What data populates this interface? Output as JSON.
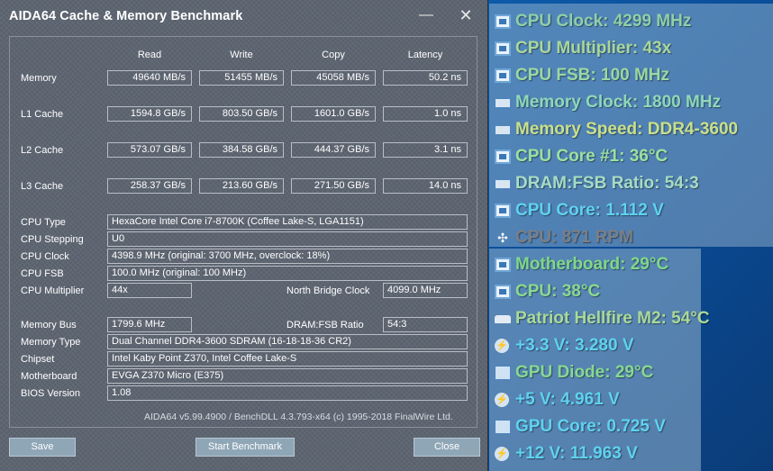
{
  "window": {
    "title": "AIDA64 Cache & Memory Benchmark",
    "min_glyph": "—",
    "close_glyph": "✕"
  },
  "columns": [
    "Read",
    "Write",
    "Copy",
    "Latency"
  ],
  "bench_rows": [
    {
      "label": "Memory",
      "read": "49640 MB/s",
      "write": "51455 MB/s",
      "copy": "45058 MB/s",
      "latency": "50.2 ns"
    },
    {
      "label": "L1 Cache",
      "read": "1594.8 GB/s",
      "write": "803.50 GB/s",
      "copy": "1601.0 GB/s",
      "latency": "1.0 ns"
    },
    {
      "label": "L2 Cache",
      "read": "573.07 GB/s",
      "write": "384.58 GB/s",
      "copy": "444.37 GB/s",
      "latency": "3.1 ns"
    },
    {
      "label": "L3 Cache",
      "read": "258.37 GB/s",
      "write": "213.60 GB/s",
      "copy": "271.50 GB/s",
      "latency": "14.0 ns"
    }
  ],
  "info": {
    "cpu_type": {
      "label": "CPU Type",
      "value": "HexaCore Intel Core i7-8700K  (Coffee Lake-S, LGA1151)"
    },
    "cpu_stepping": {
      "label": "CPU Stepping",
      "value": "U0"
    },
    "cpu_clock": {
      "label": "CPU Clock",
      "value": "4398.9 MHz  (original: 3700 MHz, overclock: 18%)"
    },
    "cpu_fsb": {
      "label": "CPU FSB",
      "value": "100.0 MHz  (original: 100 MHz)"
    },
    "cpu_multiplier": {
      "label": "CPU Multiplier",
      "value": "44x"
    },
    "nb_clock": {
      "label": "North Bridge Clock",
      "value": "4099.0 MHz"
    },
    "memory_bus": {
      "label": "Memory Bus",
      "value": "1799.6 MHz"
    },
    "dram_fsb": {
      "label": "DRAM:FSB Ratio",
      "value": "54:3"
    },
    "memory_type": {
      "label": "Memory Type",
      "value": "Dual Channel DDR4-3600 SDRAM  (16-18-18-36 CR2)"
    },
    "chipset": {
      "label": "Chipset",
      "value": "Intel Kaby Point Z370, Intel Coffee Lake-S"
    },
    "motherboard": {
      "label": "Motherboard",
      "value": "EVGA Z370 Micro (E375)"
    },
    "bios": {
      "label": "BIOS Version",
      "value": "1.08"
    }
  },
  "footer": "AIDA64 v5.99.4900 / BenchDLL 4.3.793-x64  (c) 1995-2018 FinalWire Ltd.",
  "buttons": {
    "save": "Save",
    "start": "Start Benchmark",
    "close": "Close"
  },
  "osd": [
    {
      "icon": "cpu-chip-icon",
      "text": "CPU Clock: 4299 MHz",
      "color": "#8fcfa8"
    },
    {
      "icon": "cpu-chip-icon",
      "text": "CPU Multiplier: 43x",
      "color": "#a9d79a"
    },
    {
      "icon": "cpu-chip-icon",
      "text": "CPU FSB: 100 MHz",
      "color": "#9ad8a2"
    },
    {
      "icon": "memory-module-icon",
      "text": "Memory Clock: 1800 MHz",
      "color": "#8fd8b8"
    },
    {
      "icon": "memory-module-icon",
      "text": "Memory Speed: DDR4-3600",
      "color": "#c9e08a"
    },
    {
      "icon": "cpu-chip-icon",
      "text": "CPU Core #1: 36°C",
      "color": "#9ce0a0"
    },
    {
      "icon": "memory-module-icon",
      "text": "DRAM:FSB Ratio: 54:3",
      "color": "#a6dcc4"
    },
    {
      "icon": "cpu-chip-icon",
      "text": "CPU Core: 1.112 V",
      "color": "#5fd2f0"
    },
    {
      "icon": "fan-icon",
      "text": "CPU: 871 RPM",
      "color": "#7a7f86"
    },
    {
      "icon": "motherboard-icon",
      "text": "Motherboard: 29°C",
      "color": "#7fd88a"
    },
    {
      "icon": "cpu-chip-icon",
      "text": "CPU: 38°C",
      "color": "#8ad890"
    },
    {
      "icon": "drive-icon",
      "text": "Patriot Hellfire M2: 54°C",
      "color": "#a9d99a"
    },
    {
      "icon": "voltage-icon",
      "text": "+3.3 V: 3.280 V",
      "color": "#5fd2f0"
    },
    {
      "icon": "gpu-icon",
      "text": "GPU Diode: 29°C",
      "color": "#86d892"
    },
    {
      "icon": "voltage-icon",
      "text": "+5 V: 4.961 V",
      "color": "#5fd2f0"
    },
    {
      "icon": "gpu-icon",
      "text": "GPU Core: 0.725 V",
      "color": "#5fd2f0"
    },
    {
      "icon": "voltage-icon",
      "text": "+12 V: 11.963 V",
      "color": "#5fd2f0"
    }
  ]
}
